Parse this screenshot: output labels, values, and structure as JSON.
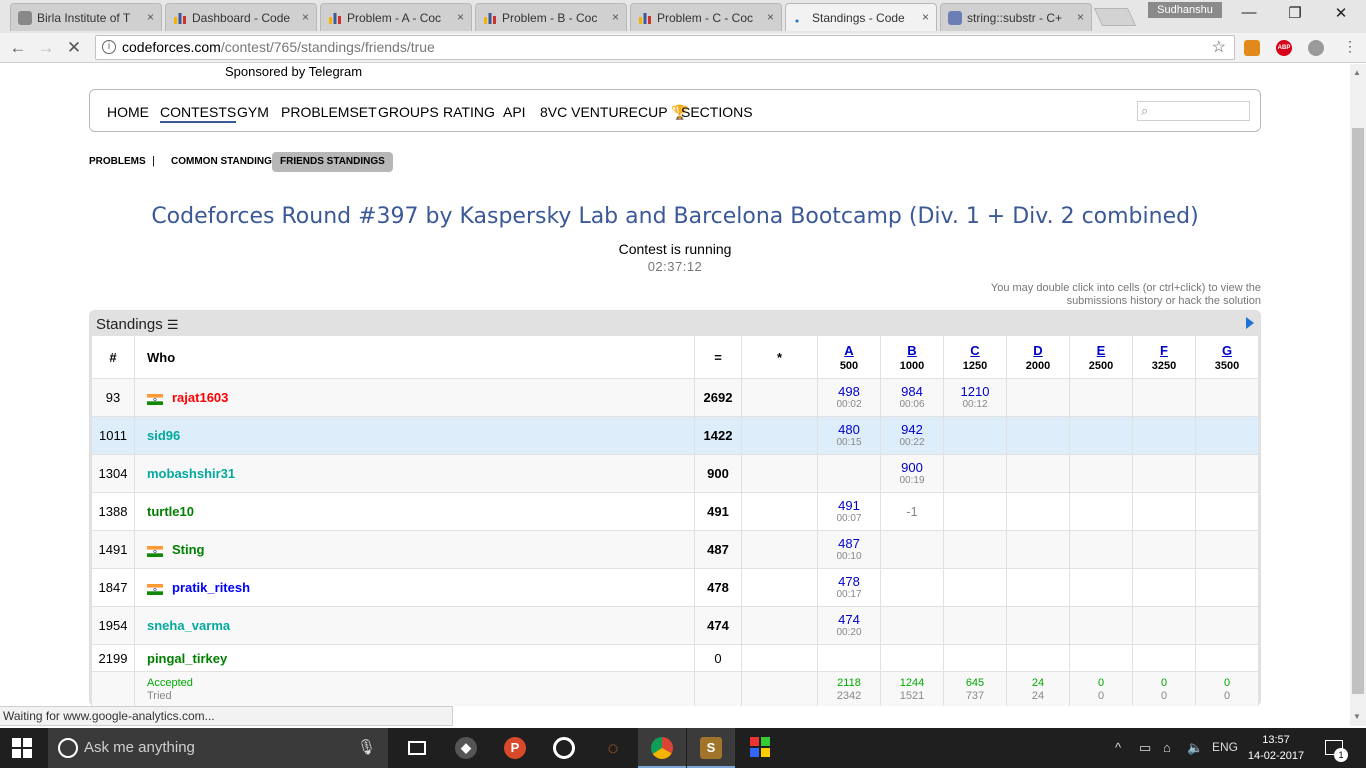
{
  "browser": {
    "tabs": [
      {
        "title": "Birla Institute of T",
        "active": false,
        "icon": "site-icon"
      },
      {
        "title": "Dashboard - Code",
        "active": false,
        "icon": "codeforces-icon"
      },
      {
        "title": "Problem - A - Coc",
        "active": false,
        "icon": "codeforces-icon"
      },
      {
        "title": "Problem - B - Coc",
        "active": false,
        "icon": "codeforces-icon"
      },
      {
        "title": "Problem - C - Coc",
        "active": false,
        "icon": "codeforces-icon"
      },
      {
        "title": "Standings - Code",
        "active": true,
        "icon": "loading-icon"
      },
      {
        "title": "string::substr - C+",
        "active": false,
        "icon": "cplusplus-icon"
      }
    ],
    "tab_close": "×",
    "profile_name": "Sudhanshu",
    "url_domain": "codeforces.com",
    "url_path": "/contest/765/standings/friends/true",
    "status_text": "Waiting for www.google-analytics.com..."
  },
  "page": {
    "sponsor": "Sponsored by Telegram",
    "menu": [
      "HOME",
      "CONTESTS",
      "GYM",
      "PROBLEMSET",
      "GROUPS",
      "RATING",
      "API",
      "8VC VENTURECUP",
      "SECTIONS"
    ],
    "menu_selected": "CONTESTS",
    "sub_menu": {
      "problems": "PROBLEMS",
      "separator": "|",
      "common": "COMMON STANDINGS",
      "friends": "FRIENDS STANDINGS"
    },
    "contest_title": "Codeforces Round #397 by Kaspersky Lab and Barcelona Bootcamp (Div. 1 + Div. 2 combined)",
    "contest_status": "Contest is running",
    "contest_timer": "02:37:12",
    "hint_line1": "You may double click into cells (or ctrl+click) to view the",
    "hint_line2": "submissions history or hack the solution"
  },
  "standings": {
    "caption": "Standings",
    "headers": {
      "rank": "#",
      "who": "Who",
      "points": "=",
      "penalty": "*"
    },
    "problems": [
      {
        "letter": "A",
        "points": "500"
      },
      {
        "letter": "B",
        "points": "1000"
      },
      {
        "letter": "C",
        "points": "1250"
      },
      {
        "letter": "D",
        "points": "2000"
      },
      {
        "letter": "E",
        "points": "2500"
      },
      {
        "letter": "F",
        "points": "3250"
      },
      {
        "letter": "G",
        "points": "3500"
      }
    ],
    "rows": [
      {
        "rank": "93",
        "handle": "rajat1603",
        "color": "#ff0000",
        "flag": true,
        "points": "2692",
        "highlight": false,
        "cells": [
          {
            "score": "498",
            "time": "00:02"
          },
          {
            "score": "984",
            "time": "00:06"
          },
          {
            "score": "1210",
            "time": "00:12"
          },
          {},
          {},
          {},
          {}
        ]
      },
      {
        "rank": "1011",
        "handle": "sid96",
        "color": "#03a89e",
        "flag": false,
        "points": "1422",
        "highlight": true,
        "cells": [
          {
            "score": "480",
            "time": "00:15"
          },
          {
            "score": "942",
            "time": "00:22"
          },
          {},
          {},
          {},
          {},
          {}
        ]
      },
      {
        "rank": "1304",
        "handle": "mobashshir31",
        "color": "#03a89e",
        "flag": false,
        "points": "900",
        "highlight": false,
        "cells": [
          {},
          {
            "score": "900",
            "time": "00:19"
          },
          {},
          {},
          {},
          {},
          {}
        ]
      },
      {
        "rank": "1388",
        "handle": "turtle10",
        "color": "#008000",
        "flag": false,
        "points": "491",
        "highlight": false,
        "cells": [
          {
            "score": "491",
            "time": "00:07"
          },
          {
            "neg": "-1"
          },
          {},
          {},
          {},
          {},
          {}
        ]
      },
      {
        "rank": "1491",
        "handle": "Sting",
        "color": "#008000",
        "flag": true,
        "points": "487",
        "highlight": false,
        "cells": [
          {
            "score": "487",
            "time": "00:10"
          },
          {},
          {},
          {},
          {},
          {},
          {}
        ]
      },
      {
        "rank": "1847",
        "handle": "pratik_ritesh",
        "color": "#0000ff",
        "flag": true,
        "points": "478",
        "highlight": false,
        "cells": [
          {
            "score": "478",
            "time": "00:17"
          },
          {},
          {},
          {},
          {},
          {},
          {}
        ]
      },
      {
        "rank": "1954",
        "handle": "sneha_varma",
        "color": "#03a89e",
        "flag": false,
        "points": "474",
        "highlight": false,
        "cells": [
          {
            "score": "474",
            "time": "00:20"
          },
          {},
          {},
          {},
          {},
          {},
          {}
        ]
      },
      {
        "rank": "2199",
        "handle": "pingal_tirkey",
        "color": "#008000",
        "flag": false,
        "points": "0",
        "highlight": false,
        "plain_points": true,
        "cells": [
          {},
          {},
          {},
          {},
          {},
          {},
          {}
        ]
      }
    ],
    "footer": {
      "accepted_label": "Accepted",
      "tried_label": "Tried",
      "accepted": [
        "2118",
        "1244",
        "645",
        "24",
        "0",
        "0",
        "0"
      ],
      "tried": [
        "2342",
        "1521",
        "737",
        "24",
        "0",
        "0",
        "0"
      ]
    }
  },
  "taskbar": {
    "search_placeholder": "Ask me anything",
    "language": "ENG",
    "time": "13:57",
    "date": "14-02-2017",
    "notifications": "1"
  }
}
